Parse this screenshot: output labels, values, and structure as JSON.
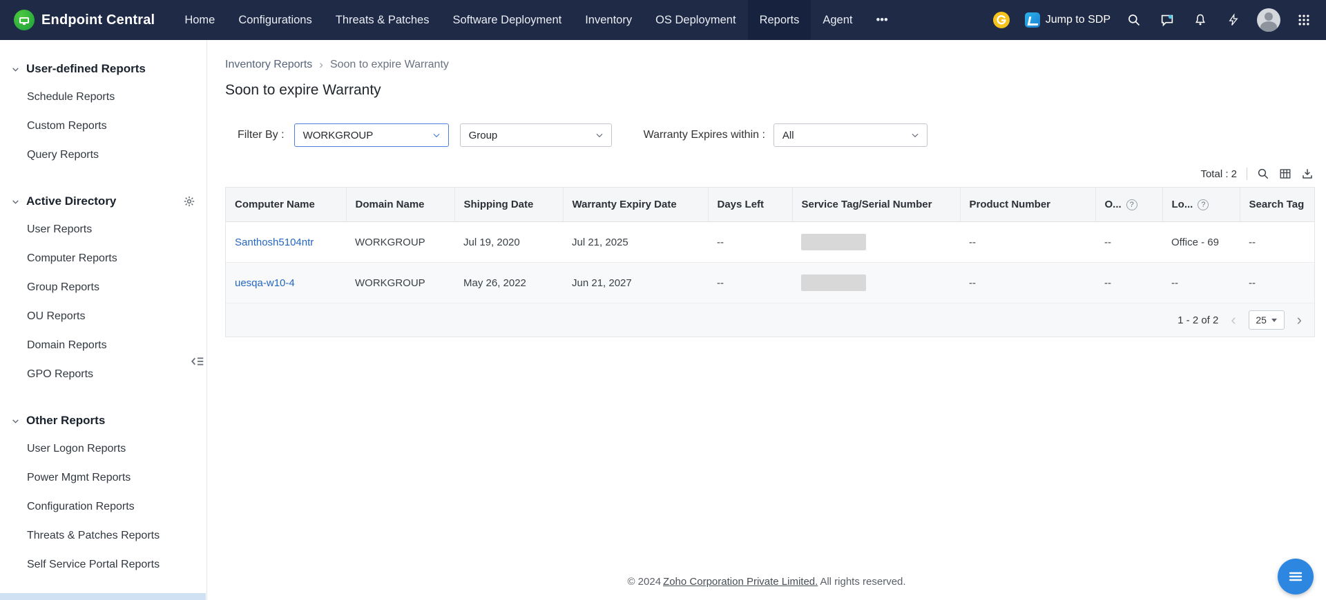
{
  "colors": {
    "topbar": "#1f2a46",
    "accent_border": "#4a7fd9",
    "link": "#2567c0",
    "fab": "#2d86e0"
  },
  "topbar": {
    "brand": "Endpoint Central",
    "nav": [
      {
        "label": "Home"
      },
      {
        "label": "Configurations"
      },
      {
        "label": "Threats & Patches"
      },
      {
        "label": "Software Deployment"
      },
      {
        "label": "Inventory"
      },
      {
        "label": "OS Deployment"
      },
      {
        "label": "Reports"
      },
      {
        "label": "Agent"
      },
      {
        "label": "•••"
      }
    ],
    "jump_to_sdp_label": "Jump to SDP"
  },
  "sidebar": {
    "sections": [
      {
        "title": "User-defined Reports",
        "items": [
          {
            "label": "Schedule Reports"
          },
          {
            "label": "Custom Reports"
          },
          {
            "label": "Query Reports"
          }
        ]
      },
      {
        "title": "Active Directory",
        "items": [
          {
            "label": "User Reports"
          },
          {
            "label": "Computer Reports"
          },
          {
            "label": "Group Reports"
          },
          {
            "label": "OU Reports"
          },
          {
            "label": "Domain Reports"
          },
          {
            "label": "GPO Reports"
          }
        ]
      },
      {
        "title": "Other Reports",
        "items": [
          {
            "label": "User Logon Reports"
          },
          {
            "label": "Power Mgmt Reports"
          },
          {
            "label": "Configuration Reports"
          },
          {
            "label": "Threats & Patches Reports"
          },
          {
            "label": "Self Service Portal Reports"
          }
        ]
      }
    ]
  },
  "breadcrumb": {
    "parent": "Inventory Reports",
    "current": "Soon to expire Warranty"
  },
  "page_title": "Soon to expire Warranty",
  "filters": {
    "filter_by_label": "Filter By :",
    "scope_value": "WORKGROUP",
    "group_value": "Group",
    "warranty_label": "Warranty Expires within :",
    "warranty_value": "All"
  },
  "toolbar": {
    "total_label": "Total : 2"
  },
  "table": {
    "headers": [
      "Computer Name",
      "Domain Name",
      "Shipping Date",
      "Warranty Expiry Date",
      "Days Left",
      "Service Tag/Serial Number",
      "Product Number",
      "O...",
      "Lo...",
      "Search Tag"
    ],
    "rows": [
      {
        "computer_name": "Santhosh5104ntr",
        "domain_name": "WORKGROUP",
        "shipping_date": "Jul 19, 2020",
        "warranty_expiry_date": "Jul 21, 2025",
        "days_left": "--",
        "product_number": "--",
        "col_o": "--",
        "col_lo": "Office - 69",
        "search_tag": "--"
      },
      {
        "computer_name": "uesqa-w10-4",
        "domain_name": "WORKGROUP",
        "shipping_date": "May 26, 2022",
        "warranty_expiry_date": "Jun 21, 2027",
        "days_left": "--",
        "product_number": "--",
        "col_o": "--",
        "col_lo": "--",
        "search_tag": "--"
      }
    ]
  },
  "pagination": {
    "range": "1 - 2 of 2",
    "page_size": "25",
    "prev": "‹",
    "next": "›"
  },
  "footer": {
    "prefix": "© 2024",
    "link": "Zoho Corporation Private Limited.",
    "suffix": "All rights reserved."
  },
  "icons": {
    "breadcrumb_separator": "›",
    "help": "?"
  }
}
